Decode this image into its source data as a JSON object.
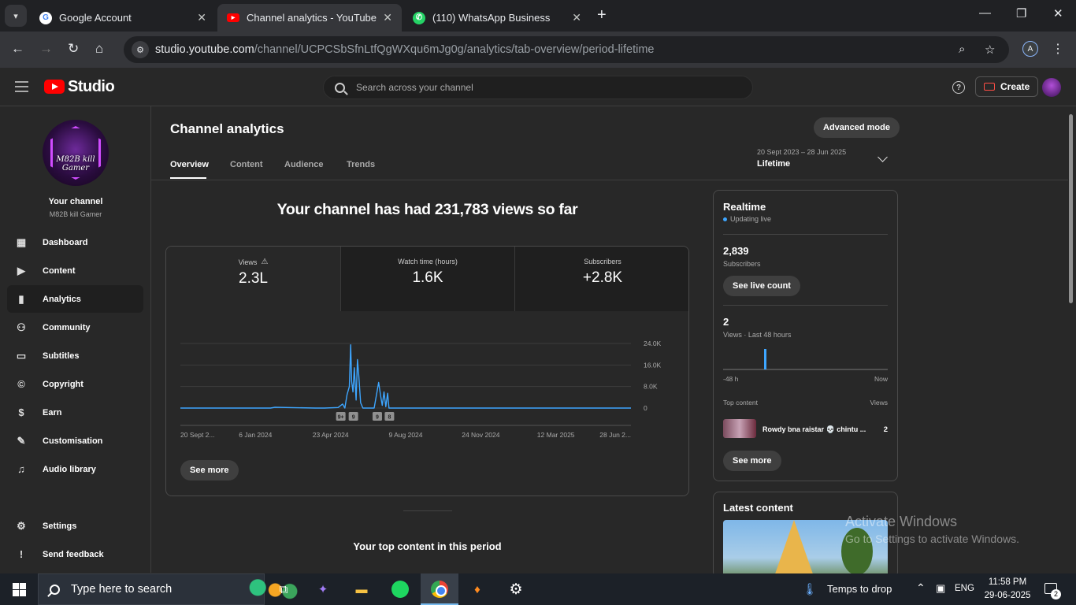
{
  "browser": {
    "tabs": [
      {
        "title": "Google Account",
        "icon": "google-icon"
      },
      {
        "title": "Channel analytics - YouTube Stu",
        "icon": "youtube-icon"
      },
      {
        "title": "(110) WhatsApp Business",
        "icon": "whatsapp-icon"
      }
    ],
    "url_host": "studio.youtube.com",
    "url_path": "/channel/UCPCSbSfnLtfQgWXqu6mJg0g/analytics/tab-overview/period-lifetime",
    "profile_letter": "A"
  },
  "header": {
    "logo_text": "Studio",
    "search_placeholder": "Search across your channel",
    "create_label": "Create"
  },
  "sidebar": {
    "avatar_text_line1": "M82B kill",
    "avatar_text_line2": "Gamer",
    "your_channel": "Your channel",
    "channel_name": "M82B kill Gamer",
    "items": [
      {
        "label": "Dashboard",
        "icon": "dashboard-icon"
      },
      {
        "label": "Content",
        "icon": "content-icon"
      },
      {
        "label": "Analytics",
        "icon": "analytics-icon"
      },
      {
        "label": "Community",
        "icon": "community-icon"
      },
      {
        "label": "Subtitles",
        "icon": "subtitles-icon"
      },
      {
        "label": "Copyright",
        "icon": "copyright-icon"
      },
      {
        "label": "Earn",
        "icon": "earn-icon"
      },
      {
        "label": "Customisation",
        "icon": "customisation-icon"
      },
      {
        "label": "Audio library",
        "icon": "audio-library-icon"
      }
    ],
    "settings": "Settings",
    "feedback": "Send feedback"
  },
  "main": {
    "title": "Channel analytics",
    "advanced_mode": "Advanced mode",
    "tabs": [
      "Overview",
      "Content",
      "Audience",
      "Trends"
    ],
    "period_range": "20 Sept 2023 – 28 Jun 2025",
    "period_name": "Lifetime",
    "headline": "Your channel has had 231,783 views so far",
    "metrics": [
      {
        "label": "Views",
        "value": "2.3L"
      },
      {
        "label": "Watch time (hours)",
        "value": "1.6K"
      },
      {
        "label": "Subscribers",
        "value": "+2.8K"
      }
    ],
    "see_more": "See more",
    "top_content_title": "Your top content in this period"
  },
  "chart_data": {
    "type": "line",
    "series_color": "#3ea6ff",
    "yticks": [
      "24.0K",
      "16.0K",
      "8.0K",
      "0"
    ],
    "ylim": [
      0,
      24000
    ],
    "xticks": [
      "20 Sept 2...",
      "6 Jan 2024",
      "23 Apr 2024",
      "9 Aug 2024",
      "24 Nov 2024",
      "12 Mar 2025",
      "28 Jun 2..."
    ],
    "markers": [
      "9+",
      "9",
      "9",
      "8"
    ],
    "x": [
      0,
      0.2,
      0.21,
      0.3,
      0.32,
      0.35,
      0.36,
      0.365,
      0.37,
      0.375,
      0.378,
      0.38,
      0.383,
      0.386,
      0.39,
      0.393,
      0.396,
      0.4,
      0.405,
      0.41,
      0.43,
      0.44,
      0.445,
      0.448,
      0.452,
      0.456,
      0.46,
      0.463,
      0.47,
      0.5,
      0.6,
      0.8,
      1.0
    ],
    "values": [
      0,
      0,
      300,
      0,
      0,
      200,
      1500,
      0,
      5000,
      8000,
      23500,
      10000,
      6000,
      15000,
      3000,
      18000,
      12000,
      2000,
      0,
      0,
      0,
      9500,
      4000,
      1000,
      6000,
      500,
      5500,
      0,
      0,
      0,
      0,
      0,
      0
    ]
  },
  "realtime": {
    "title": "Realtime",
    "status": "Updating live",
    "subscribers": "2,839",
    "subscribers_label": "Subscribers",
    "see_live_count": "See live count",
    "views": "2",
    "views_label": "Views · Last 48 hours",
    "bars_left": "-48 h",
    "bars_right": "Now",
    "top_content_label": "Top content",
    "views_col": "Views",
    "top_item_title": "Rowdy bna raistar 💀 chintu ...",
    "top_item_views": "2",
    "see_more": "See more"
  },
  "latest": {
    "title": "Latest content"
  },
  "watermark": {
    "line1": "Activate Windows",
    "line2": "Go to Settings to activate Windows."
  },
  "taskbar": {
    "search_text": "Type here to search",
    "temps": "Temps to drop",
    "lang": "ENG",
    "time": "11:58 PM",
    "date": "29-06-2025",
    "notifications": "2"
  }
}
